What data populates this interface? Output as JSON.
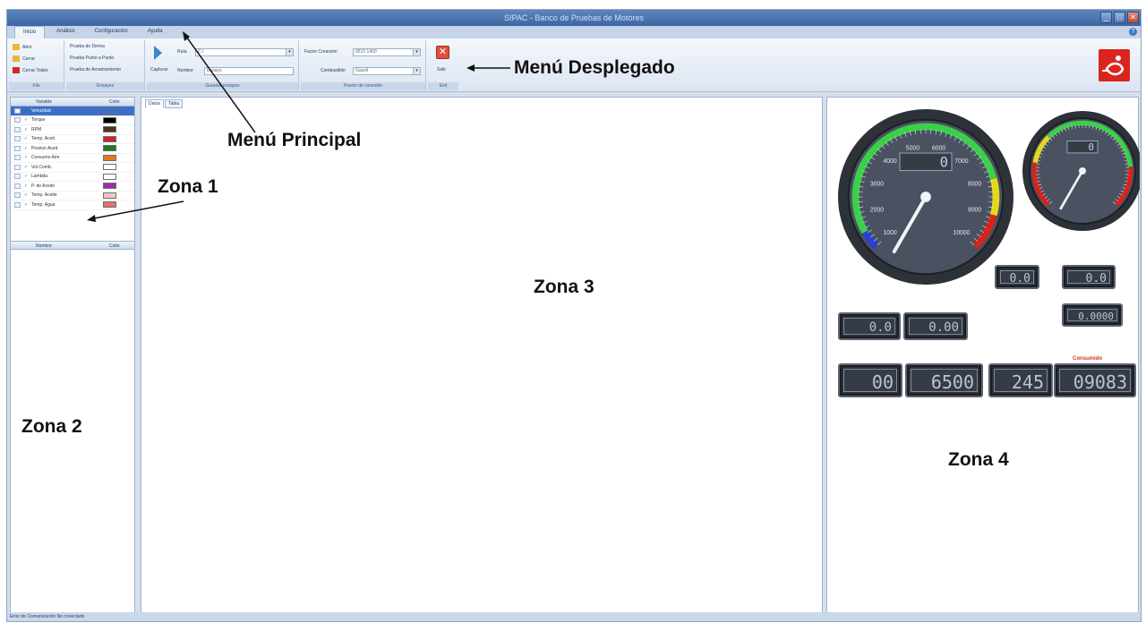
{
  "window": {
    "title": "SIPAC - Banco de Pruebas de Motores",
    "buttons": [
      "_",
      "□",
      "✕"
    ]
  },
  "main_tabs": [
    {
      "label": "Inicio",
      "active": true
    },
    {
      "label": "Análisis",
      "active": false
    },
    {
      "label": "Configuración",
      "active": false
    },
    {
      "label": "Ayuda",
      "active": false
    }
  ],
  "ribbon": {
    "file_group": {
      "label": "File",
      "items": [
        "Abrir",
        "Cerrar",
        "Cerrar Todos"
      ]
    },
    "ensayos_group": {
      "label": "Ensayos",
      "items": [
        "Prueba de Deriva",
        "Prueba Punto a Punto",
        "Prueba de Arrastramiento"
      ]
    },
    "ruta_group": {
      "label": "Guardar ensayos",
      "ruta_label": "Ruta",
      "ruta_value": "C:\\",
      "nombre_label": "Nombre",
      "nombre_value": "Ensayo",
      "capturar_label": "Capturar"
    },
    "com_group": {
      "label": "Puerto de conexión",
      "factor_label": "Factor Conexión",
      "factor_value": "9515 1400",
      "combustible_label": "Combustible",
      "combustible_value": "Gasoil"
    },
    "exit_group": {
      "label": "Exit",
      "salir_label": "Salir"
    }
  },
  "variables_table": {
    "headers": [
      "Variable",
      "Color"
    ],
    "rows": [
      {
        "name": "Velocidad",
        "color": "#3a6bd0",
        "selected": true
      },
      {
        "name": "Torque",
        "color": "#000000",
        "selected": false
      },
      {
        "name": "RPM",
        "color": "#4a3320",
        "selected": false
      },
      {
        "name": "Temp. Aceit.",
        "color": "#d42222",
        "selected": false
      },
      {
        "name": "Presion Aceit.",
        "color": "#1d7a1d",
        "selected": false
      },
      {
        "name": "Consumo Aire",
        "color": "#e07820",
        "selected": false
      },
      {
        "name": "Vol.Comb.",
        "color": "#ffffff",
        "selected": false
      },
      {
        "name": "Lambda",
        "color": "#ffffff",
        "selected": false
      },
      {
        "name": "P. de Aceite",
        "color": "#9b2ea8",
        "selected": false
      },
      {
        "name": "Temp. Aceite",
        "color": "#f3c6c6",
        "selected": false
      },
      {
        "name": "Temp. Agua",
        "color": "#e07070",
        "selected": false
      }
    ],
    "lower_headers": [
      "Nombre",
      "Color"
    ]
  },
  "center_tabs": [
    {
      "label": "Datos",
      "active": true
    },
    {
      "label": "Tabla",
      "active": false
    }
  ],
  "gauges": {
    "big": {
      "display": "0",
      "ticks": [
        "1000",
        "2000",
        "3000",
        "4000",
        "5000",
        "6000",
        "7000",
        "8000",
        "9000",
        "10000"
      ]
    },
    "small": {
      "display": "0"
    }
  },
  "displays": {
    "d1": "0.0",
    "d2": "0.0",
    "d3": "0.0000",
    "d4": "0.0",
    "d5": "0.00",
    "d6": "00",
    "d7": "6500",
    "d8": "245",
    "d9": "09083",
    "consumido_label": "Consumido"
  },
  "status": {
    "text": "Error de Comunicación   No conectado"
  },
  "annotations": {
    "menu_desplegado": "Menú Desplegado",
    "menu_principal": "Menú Principal",
    "zona1": "Zona 1",
    "zona2": "Zona 2",
    "zona3": "Zona 3",
    "zona4": "Zona 4"
  },
  "colors": {
    "accent": "#3d6fc6",
    "gauge_green": "#3ccf4a",
    "gauge_yellow": "#e4d81c",
    "gauge_red": "#d6231b",
    "gauge_blue": "#2a3ed6",
    "logo": "#d9251f"
  }
}
